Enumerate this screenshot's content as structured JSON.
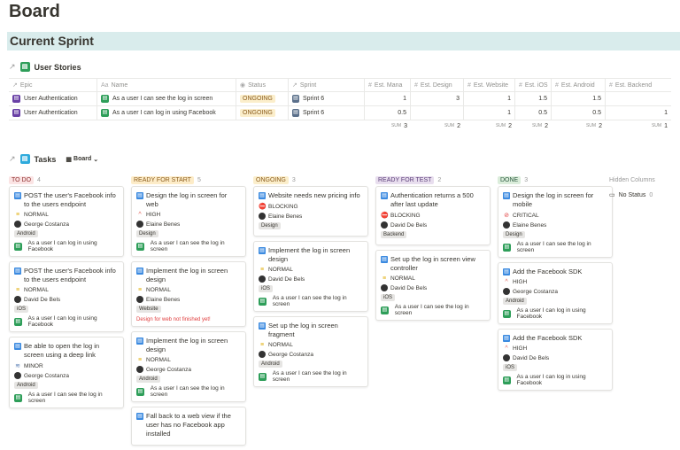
{
  "page": {
    "title": "Board",
    "section": "Current Sprint"
  },
  "colors": {
    "banner": "#d9ecec",
    "accent": "#2eaadc",
    "epic": "#6940a5",
    "story": "#2e9e59"
  },
  "stories": {
    "title": "User Stories",
    "headers": [
      "Epic",
      "Name",
      "Status",
      "Sprint",
      "Est. Mana",
      "Est. Design",
      "Est. Website",
      "Est. iOS",
      "Est. Android",
      "Est. Backend"
    ],
    "rows": [
      {
        "epic": "User Authentication",
        "name": "As a user I can see the log in screen",
        "status": "ONGOING",
        "sprint": "Sprint 6",
        "mana": "1",
        "design": "3",
        "website": "1",
        "ios": "1.5",
        "android": "1.5",
        "backend": ""
      },
      {
        "epic": "User Authentication",
        "name": "As a user I can log in using Facebook",
        "status": "ONGOING",
        "sprint": "Sprint 6",
        "mana": "0.5",
        "design": "",
        "website": "1",
        "ios": "0.5",
        "android": "0.5",
        "backend": "1"
      }
    ],
    "sum_label": "SUM",
    "sums": {
      "mana": "3",
      "design": "2",
      "website": "2",
      "ios": "2",
      "android": "2",
      "backend": "1"
    }
  },
  "tasks": {
    "title": "Tasks",
    "view": "Board"
  },
  "columns": [
    {
      "label": "TO DO",
      "count": "4",
      "color": "#fbe4e4",
      "text": "#8d2f2f",
      "cards": [
        {
          "title": "POST the user's Facebook info to the users endpoint",
          "priority": "NORMAL",
          "assignee": "George Costanza",
          "tag": "Android",
          "story": "As a user I can log in using Facebook"
        },
        {
          "title": "POST the user's Facebook info to the users endpoint",
          "priority": "NORMAL",
          "assignee": "David De Bels",
          "tag": "iOS",
          "story": "As a user I can log in using Facebook"
        },
        {
          "title": "Be able to open the log in screen using a deep link",
          "priority": "MINOR",
          "assignee": "George Costanza",
          "tag": "Android",
          "story": "As a user I can see the log in screen"
        }
      ]
    },
    {
      "label": "READY FOR START",
      "count": "5",
      "color": "#fdecc8",
      "text": "#8a5b1c",
      "cards": [
        {
          "title": "Design the log in screen for web",
          "priority": "HIGH",
          "assignee": "Elaine Benes",
          "tag": "Design",
          "story": "As a user I can see the log in screen"
        },
        {
          "title": "Implement the log in screen design",
          "priority": "NORMAL",
          "assignee": "Elaine Benes",
          "tag": "Website",
          "story": "",
          "note": "Design for web not finished yet!"
        },
        {
          "title": "Implement the log in screen design",
          "priority": "NORMAL",
          "assignee": "George Costanza",
          "tag": "Android",
          "story": "As a user I can see the log in screen"
        },
        {
          "title": "Fall back to a web view if the user has no Facebook app installed",
          "priority": "",
          "assignee": "",
          "tag": "",
          "story": ""
        }
      ]
    },
    {
      "label": "ONGOING",
      "count": "3",
      "color": "#fbeecb",
      "text": "#8a5b1c",
      "cards": [
        {
          "title": "Website needs new pricing info",
          "priority": "BLOCKING",
          "assignee": "Elaine Benes",
          "tag": "Design",
          "story": ""
        },
        {
          "title": "Implement the log in screen design",
          "priority": "NORMAL",
          "assignee": "David De Bels",
          "tag": "iOS",
          "story": "As a user I can see the log in screen"
        },
        {
          "title": "Set up the log in screen fragment",
          "priority": "NORMAL",
          "assignee": "George Costanza",
          "tag": "Android",
          "story": "As a user I can see the log in screen"
        }
      ]
    },
    {
      "label": "READY FOR TEST",
      "count": "2",
      "color": "#e8deee",
      "text": "#5a3d78",
      "cards": [
        {
          "title": "Authentication returns a 500 after last update",
          "priority": "BLOCKING",
          "assignee": "David De Bels",
          "tag": "Backend",
          "story": ""
        },
        {
          "title": "Set up the log in screen view controller",
          "priority": "NORMAL",
          "assignee": "David De Bels",
          "tag": "iOS",
          "story": "As a user I can see the log in screen"
        }
      ]
    },
    {
      "label": "DONE",
      "count": "3",
      "color": "#dbeddb",
      "text": "#2b593f",
      "cards": [
        {
          "title": "Design the log in screen for mobile",
          "priority": "CRITICAL",
          "assignee": "Elaine Benes",
          "tag": "Design",
          "story": "As a user I can see the log in screen"
        },
        {
          "title": "Add the Facebook SDK",
          "priority": "HIGH",
          "assignee": "George Costanza",
          "tag": "Android",
          "story": "As a user I can log in using Facebook"
        },
        {
          "title": "Add the Facebook SDK",
          "priority": "HIGH",
          "assignee": "David De Bels",
          "tag": "iOS",
          "story": "As a user I can log in using Facebook"
        }
      ]
    }
  ],
  "hidden": {
    "title": "Hidden Columns",
    "item": "No Status",
    "count": "0"
  }
}
